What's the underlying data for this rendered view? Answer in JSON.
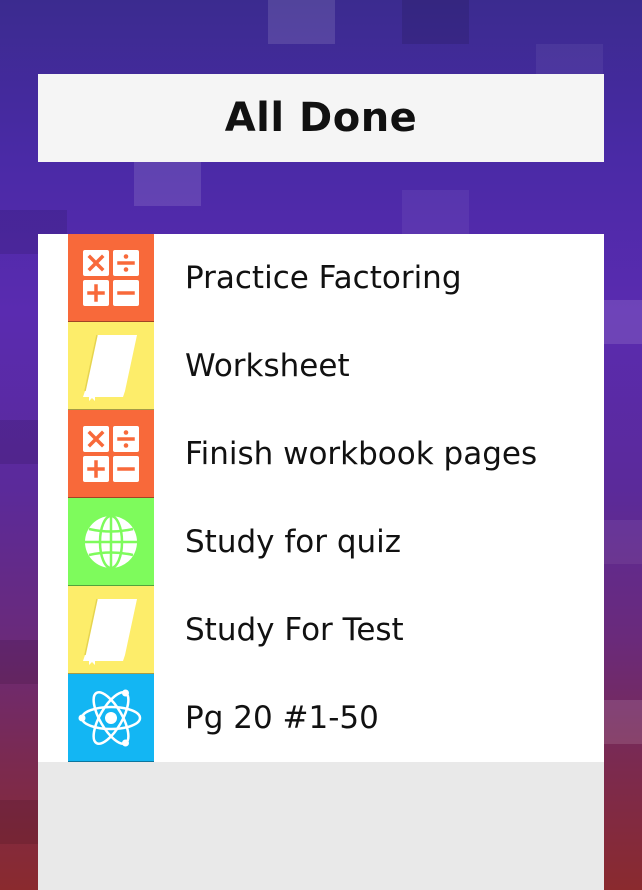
{
  "header": {
    "title": "All Done"
  },
  "colors": {
    "orange": "#f8693a",
    "yellow": "#fded6a",
    "green": "#7efb5c",
    "blue": "#13b6f3",
    "header_bg": "#f5f5f5",
    "panel_bg": "#e9e9e9"
  },
  "tasks": [
    {
      "label": "Practice Factoring",
      "icon": "math-operators-icon",
      "color": "orange"
    },
    {
      "label": "Worksheet",
      "icon": "book-icon",
      "color": "yellow"
    },
    {
      "label": "Finish workbook pages",
      "icon": "math-operators-icon",
      "color": "orange"
    },
    {
      "label": "Study for quiz",
      "icon": "globe-icon",
      "color": "green"
    },
    {
      "label": "Study For Test",
      "icon": "book-icon",
      "color": "yellow"
    },
    {
      "label": "Pg 20 #1-50",
      "icon": "atom-icon",
      "color": "blue"
    }
  ]
}
